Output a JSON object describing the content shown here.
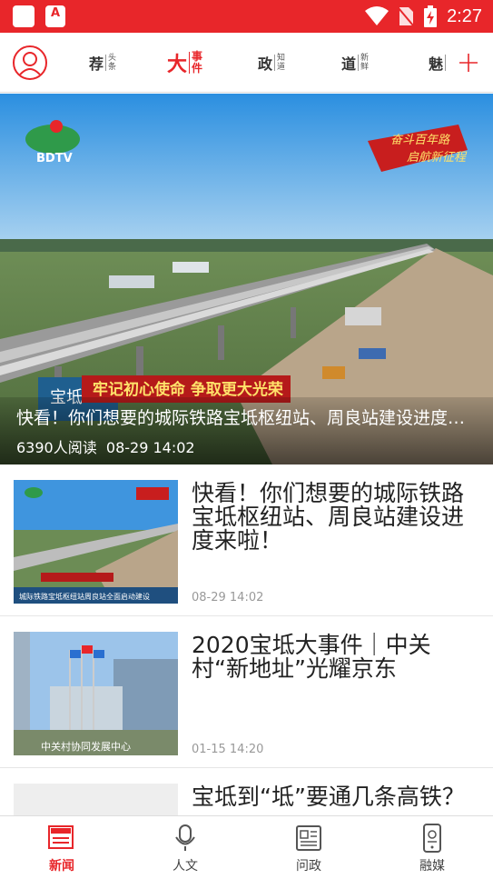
{
  "status_bar": {
    "time": "2:27",
    "app_icon_letter": "A"
  },
  "nav": {
    "channels": [
      {
        "main": "荐",
        "sub": [
          "头",
          "条"
        ],
        "active": false
      },
      {
        "main": "大",
        "sub": [
          "事",
          "件"
        ],
        "active": true
      },
      {
        "main": "政",
        "sub": [
          "知",
          "道"
        ],
        "active": false
      },
      {
        "main": "道",
        "sub": [
          "新",
          "鲜"
        ],
        "active": false
      },
      {
        "main": "魅",
        "sub": [
          "",
          ""
        ],
        "active": false
      }
    ],
    "accent_color": "#e8262a"
  },
  "hero": {
    "logo_text": "BDTV",
    "slogan_top": "奋斗百年路",
    "slogan_bottom": "启航新征程",
    "banner_text": "牢记初心使命  争取更大光荣",
    "side_label": "宝坻",
    "title": "快看！你们想要的城际铁路宝坻枢纽站、周良站建设进度来啦！",
    "reads": "6390人阅读",
    "time": "08-29 14:02"
  },
  "news": [
    {
      "title": "快看！你们想要的城际铁路宝坻枢纽站、周良站建设进度来啦！",
      "time": "08-29 14:02",
      "thumb_caption": "城际铁路宝坻枢纽站周良站全面启动建设"
    },
    {
      "title": "2020宝坻大事件｜中关村“新地址”光耀京东",
      "time": "01-15 14:20",
      "thumb_caption": "中关村协同发展中心"
    },
    {
      "title": "宝坻到“坻”要通几条高铁？",
      "time": "",
      "thumb_caption": ""
    }
  ],
  "tabs": [
    {
      "label": "新闻",
      "icon": "newspaper-icon",
      "active": true
    },
    {
      "label": "人文",
      "icon": "microphone-icon",
      "active": false
    },
    {
      "label": "问政",
      "icon": "document-icon",
      "active": false
    },
    {
      "label": "融媒",
      "icon": "phone-media-icon",
      "active": false
    }
  ]
}
